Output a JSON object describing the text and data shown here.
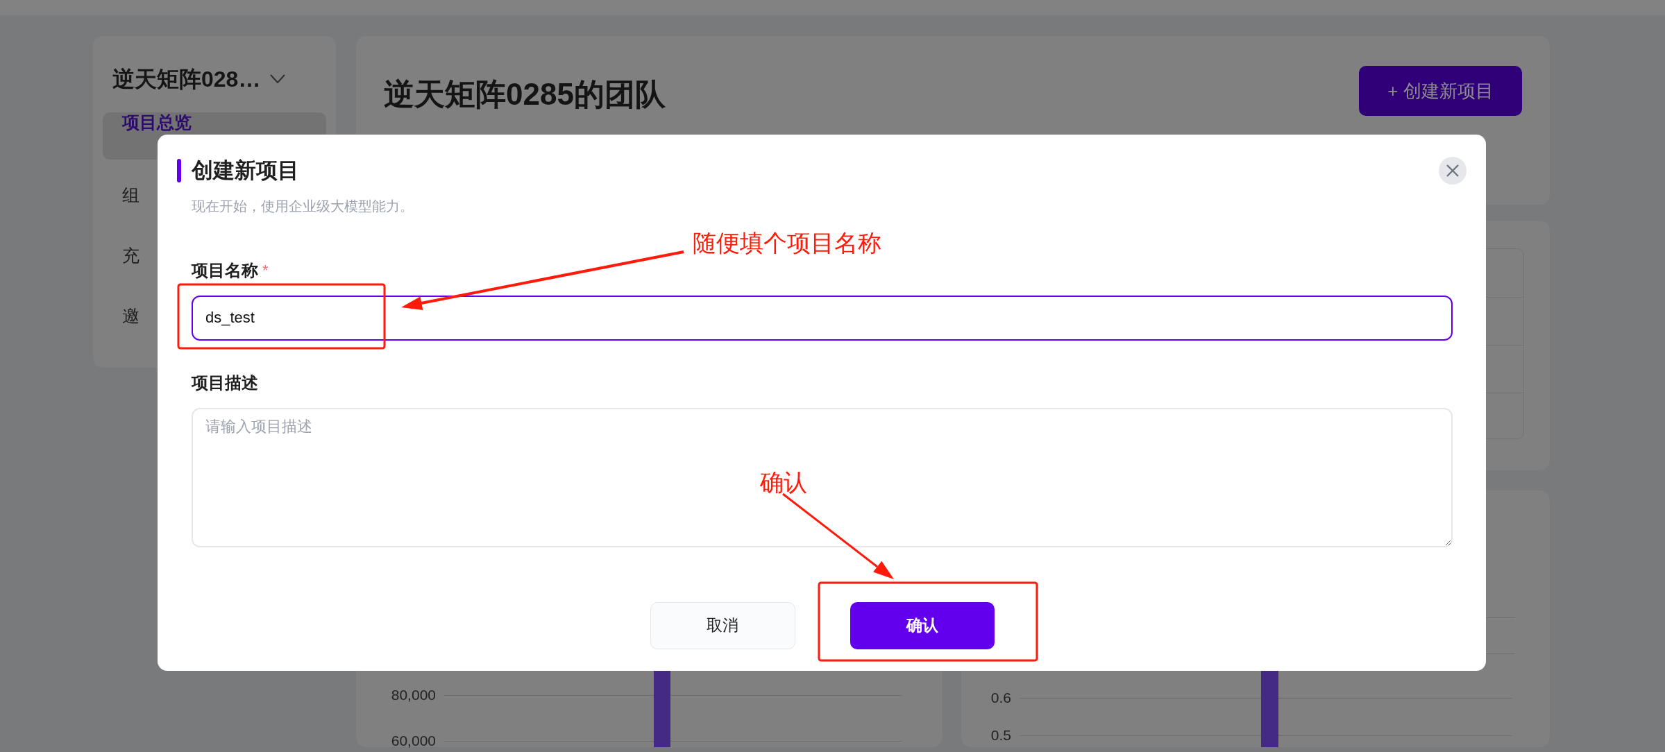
{
  "sidebar": {
    "team_name": "逆天矩阵028…",
    "items": [
      {
        "label": "项目总览",
        "selected": true
      },
      {
        "label": "组",
        "selected": false
      },
      {
        "label": "充",
        "selected": false
      },
      {
        "label": "邀",
        "selected": false
      }
    ]
  },
  "header": {
    "title": "逆天矩阵0285的团队",
    "create_button": "+ 创建新项目"
  },
  "charts": [
    {
      "axis_labels": [
        "80,000",
        "60,000"
      ]
    },
    {
      "axis_labels": [
        "0.6",
        "0.5"
      ]
    }
  ],
  "dialog": {
    "title": "创建新项目",
    "subtitle": "现在开始，使用企业级大模型能力。",
    "fields": [
      {
        "kind": "input",
        "label": "项目名称",
        "required_mark": "*",
        "value": "ds_test",
        "focused": true
      },
      {
        "kind": "textarea",
        "label": "项目描述",
        "placeholder": "请输入项目描述",
        "focused": false
      }
    ],
    "buttons": [
      {
        "label": "取消",
        "primary": false
      },
      {
        "label": "确认",
        "primary": true
      }
    ]
  },
  "annotations": [
    {
      "text": "随便填个项目名称"
    },
    {
      "text": "确认"
    }
  ]
}
